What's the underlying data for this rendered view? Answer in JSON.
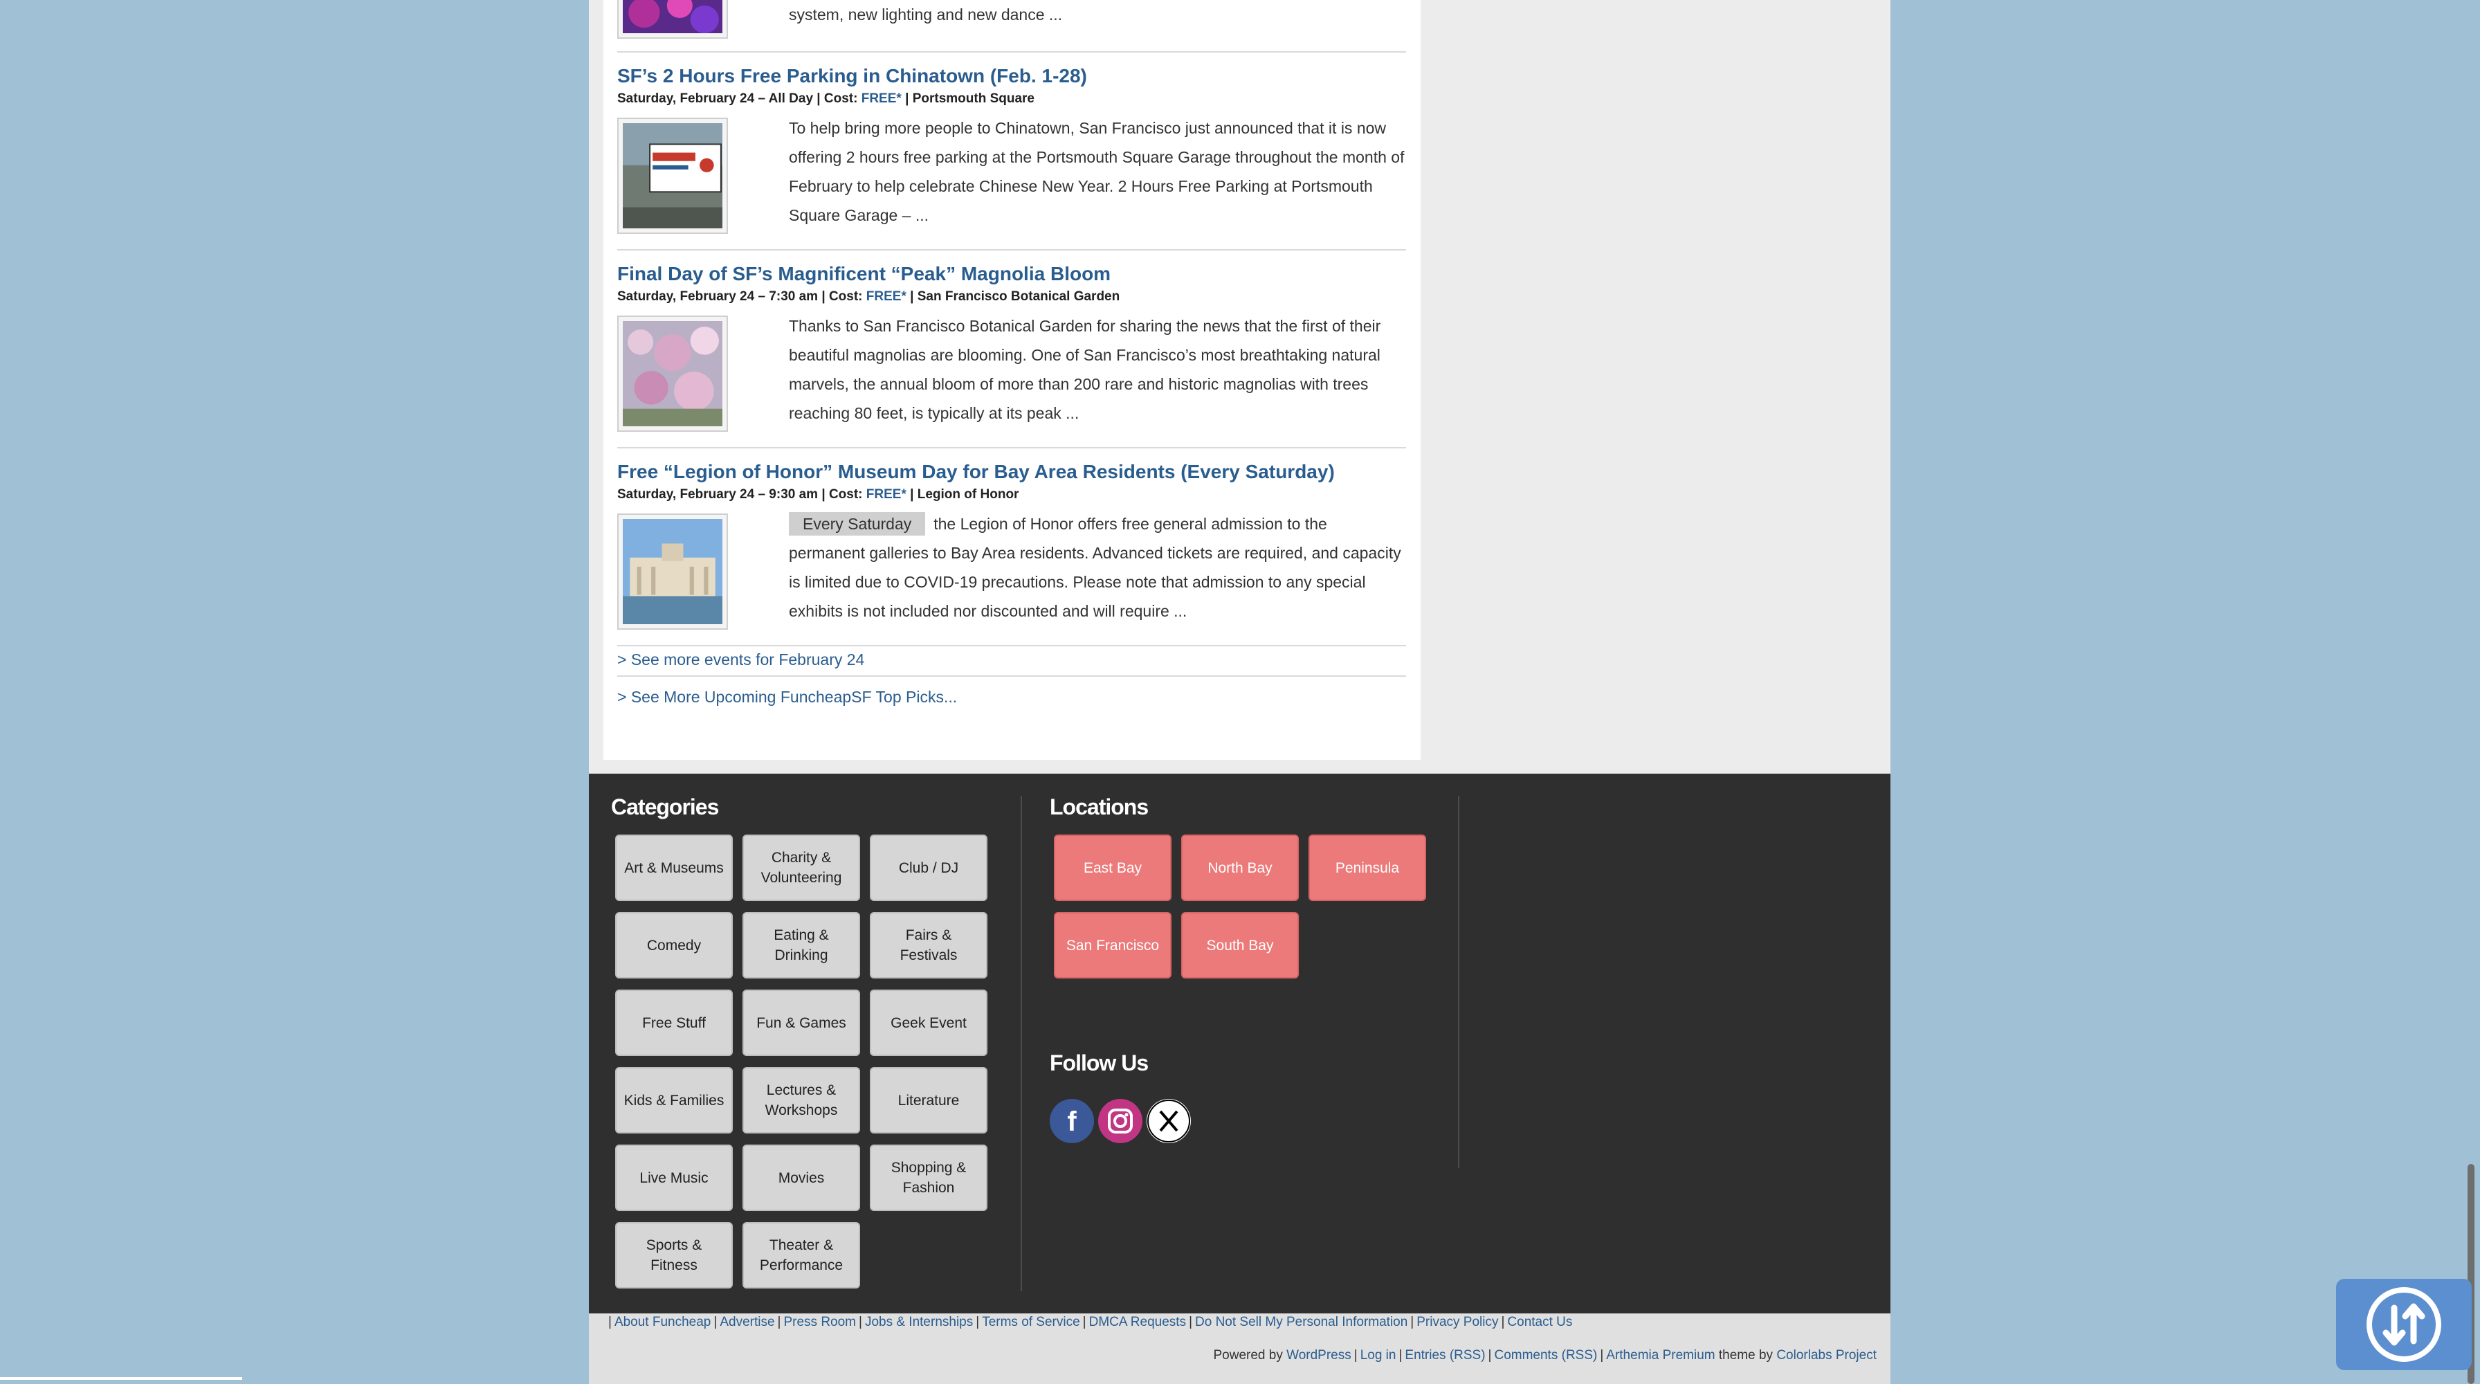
{
  "events": [
    {
      "desc": "system, new lighting and new dance ...",
      "thumb_icon": "event-photo-thumbnail"
    },
    {
      "title": "SF’s 2 Hours Free Parking in Chinatown (Feb. 1-28)",
      "date": "Saturday, February 24 – All Day",
      "cost_label": "Cost:",
      "cost": "FREE*",
      "venue": "Portsmouth Square",
      "desc": "To help bring more people to Chinatown, San Francisco just announced that it is now offering 2 hours free parking at the Portsmouth Square Garage throughout the month of February to help celebrate Chinese New Year. 2 Hours Free Parking at Portsmouth Square Garage – ..."
    },
    {
      "title": "Final Day of SF’s Magnificent “Peak” Magnolia Bloom",
      "date": "Saturday, February 24 – 7:30 am",
      "cost_label": "Cost:",
      "cost": "FREE*",
      "venue": "San Francisco Botanical Garden",
      "desc": "Thanks to San Francisco Botanical Garden for sharing the news that the first of their beautiful magnolias are blooming. One of San Francisco’s most breathtaking natural marvels, the annual bloom of more than 200 rare and historic magnolias with trees reaching 80 feet, is typically at its peak ..."
    },
    {
      "title": "Free “Legion of Honor” Museum Day for Bay Area Residents (Every Saturday)",
      "date": "Saturday, February 24 – 9:30 am",
      "cost_label": "Cost:",
      "cost": "FREE*",
      "venue": "Legion of Honor",
      "badge": "Every Saturday",
      "desc": "the Legion of Honor offers free general admission to the permanent galleries to Bay Area residents. Advanced tickets are required, and capacity is limited due to COVID-19 precautions. Please note that admission to any special exhibits is not included nor discounted and will require ..."
    }
  ],
  "see_more_events": "> See more events for February 24",
  "see_more_picks": "> See More Upcoming FuncheapSF Top Picks...",
  "categories": {
    "title": "Categories",
    "items": [
      "Art & Museums",
      "Charity & Volunteering",
      "Club / DJ",
      "Comedy",
      "Eating & Drinking",
      "Fairs & Festivals",
      "Free Stuff",
      "Fun & Games",
      "Geek Event",
      "Kids & Families",
      "Lectures & Workshops",
      "Literature",
      "Live Music",
      "Movies",
      "Shopping & Fashion",
      "Sports & Fitness",
      "Theater & Performance"
    ]
  },
  "locations": {
    "title": "Locations",
    "items": [
      "East Bay",
      "North Bay",
      "Peninsula",
      "San Francisco",
      "South Bay"
    ]
  },
  "follow": {
    "title": "Follow Us",
    "icons": [
      "facebook-icon",
      "instagram-icon",
      "x-icon"
    ]
  },
  "footer_links": [
    "About Funcheap",
    "Advertise",
    "Press Room",
    "Jobs & Internships",
    "Terms of Service",
    "DMCA Requests",
    "Do Not Sell My Personal Information",
    "Privacy Policy",
    "Contact Us"
  ],
  "powered": {
    "prefix": "Powered by",
    "wordpress": "WordPress",
    "login": "Log in",
    "entries": "Entries (RSS)",
    "comments": "Comments (RSS)",
    "theme": "Arthemia Premium",
    "theme_suffix": "theme by",
    "colorlabs": "Colorlabs Project"
  },
  "colors": {
    "link": "#2a5d8f",
    "location_button": "#ec7a7a",
    "category_button": "#d6d6d6",
    "footer_dark": "#2f2f2f",
    "page_bg": "#9fc0d5"
  },
  "accessibility_icon": "accessibility-toggle-icon"
}
